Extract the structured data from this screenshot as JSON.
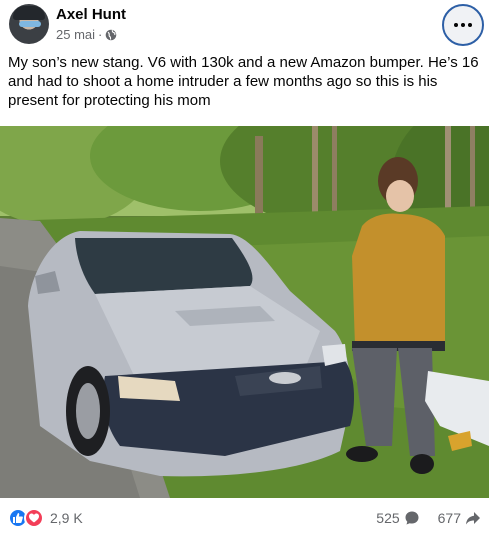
{
  "post": {
    "author": "Axel Hunt",
    "date": "25 mai",
    "separator": "·",
    "text": "My son’s new stang. V6 with 130k and a new Amazon bumper. He’s 16 and had to shoot a home intruder a few months ago so this is his present for protecting his mom",
    "audience_icon": "globe-icon",
    "more_icon": "more-options-icon"
  },
  "stats": {
    "reactions_count": "2,9 K",
    "comments_count": "525",
    "shares_count": "677",
    "reaction_icons": [
      "like-icon",
      "love-icon"
    ]
  },
  "colors": {
    "accent": "#1877f2",
    "love": "#f33e58",
    "secondary_text": "#65676b"
  }
}
